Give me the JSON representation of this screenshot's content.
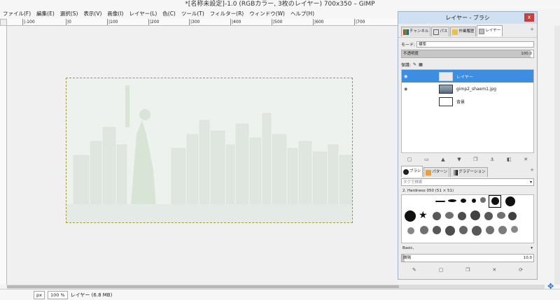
{
  "window": {
    "title": "*[名称未設定]-1.0 (RGBカラー, 3枚のレイヤー) 700x350 – GIMP"
  },
  "menu": [
    "ファイル(F)",
    "編集(E)",
    "選択(S)",
    "表示(V)",
    "画像(I)",
    "レイヤー(L)",
    "色(C)",
    "ツール(T)",
    "フィルター(R)",
    "ウィンドウ(W)",
    "ヘルプ(H)"
  ],
  "ruler": [
    "|-100",
    "|0",
    "|100",
    "|200",
    "|300",
    "|400",
    "|500",
    "|600",
    "|700"
  ],
  "status": {
    "unit": "px",
    "zoom": "100 %",
    "info": "レイヤー (6.8 MB)"
  },
  "dock": {
    "title": "レイヤー - ブラシ",
    "close": "x",
    "plus": "+",
    "tabs": [
      "チャンネル",
      "パス",
      "作業履歴",
      "レイヤー"
    ],
    "mode_label": "モード:",
    "mode_value": "標準",
    "opacity_label": "不透明度",
    "opacity_value": "100.0",
    "lock_label": "保護:",
    "layers": [
      {
        "name": "レイヤー",
        "active": true
      },
      {
        "name": "gimp2_shaem1.jpg",
        "active": false
      },
      {
        "name": "背景",
        "active": false
      }
    ],
    "brush_tabs": [
      "ブラシ",
      "パターン",
      "グラデーション"
    ],
    "tag_placeholder": "タグで検索",
    "brush_name": "2. Hardness 050 (51 × 51)",
    "preset": "Basic,",
    "spacing_label": "間隔",
    "spacing_value": "10.0"
  }
}
